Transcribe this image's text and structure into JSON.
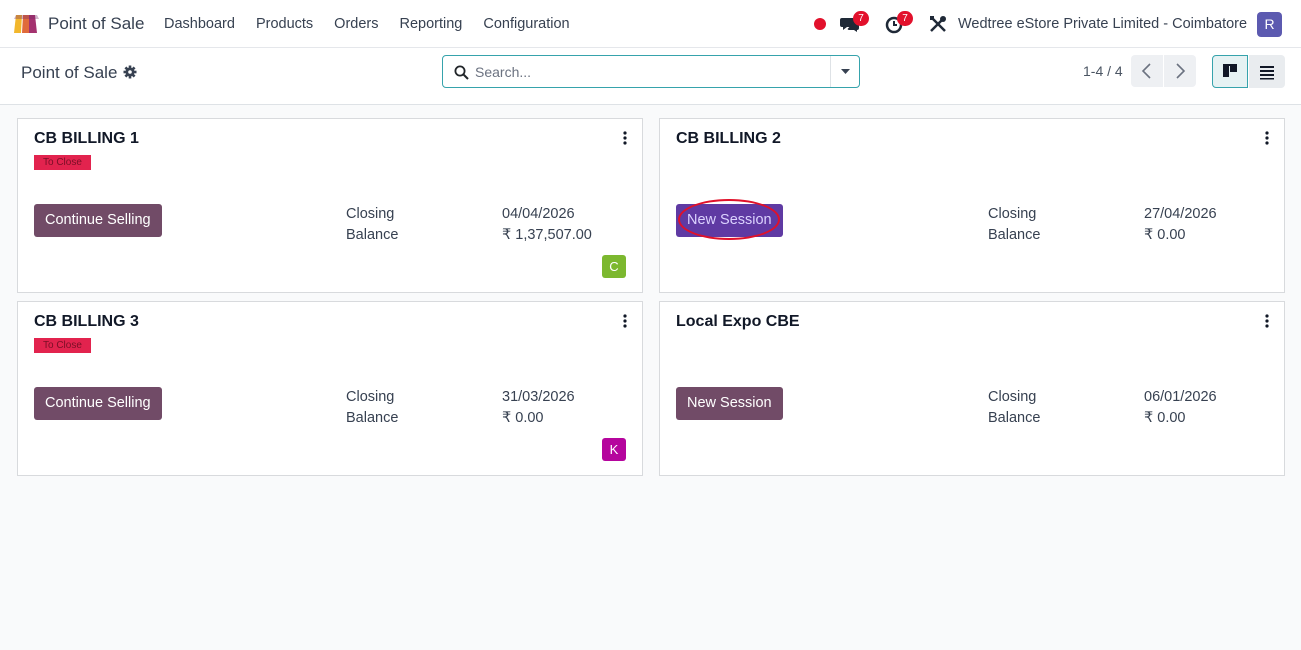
{
  "navbar": {
    "app_name": "Point of Sale",
    "menu": [
      "Dashboard",
      "Products",
      "Orders",
      "Reporting",
      "Configuration"
    ],
    "messages_count": "7",
    "activities_count": "7",
    "company": "Wedtree eStore Private Limited - Coimbatore",
    "user_initial": "R",
    "icons": [
      "pos-logo-icon",
      "recording-dot-icon",
      "chat-icon",
      "clock-icon",
      "tools-icon"
    ]
  },
  "control": {
    "title": "Point of Sale",
    "search_placeholder": "Search...",
    "pager": "1-4 / 4"
  },
  "cards": [
    {
      "name": "CB BILLING 1",
      "tag": "To Close",
      "button": "Continue Selling",
      "closing_label": "Closing",
      "closing_date": "04/04/2026",
      "balance_label": "Balance",
      "balance": "₹ 1,37,507.00",
      "user": "C",
      "user_color": "#7cb82f"
    },
    {
      "name": "CB BILLING 2",
      "tag": "",
      "button": "New Session",
      "closing_label": "Closing",
      "closing_date": "27/04/2026",
      "balance_label": "Balance",
      "balance": "₹ 0.00",
      "user": "",
      "highlighted": true
    },
    {
      "name": "CB BILLING 3",
      "tag": "To Close",
      "button": "Continue Selling",
      "closing_label": "Closing",
      "closing_date": "31/03/2026",
      "balance_label": "Balance",
      "balance": "₹ 0.00",
      "user": "K",
      "user_color": "#b5059d"
    },
    {
      "name": "Local Expo CBE",
      "tag": "",
      "button": "New Session",
      "closing_label": "Closing",
      "closing_date": "06/01/2026",
      "balance_label": "Balance",
      "balance": "₹ 0.00",
      "user": ""
    }
  ],
  "colors": {
    "primary": "#714b67",
    "accent": "#36a3ac",
    "danger": "#e2112c"
  }
}
